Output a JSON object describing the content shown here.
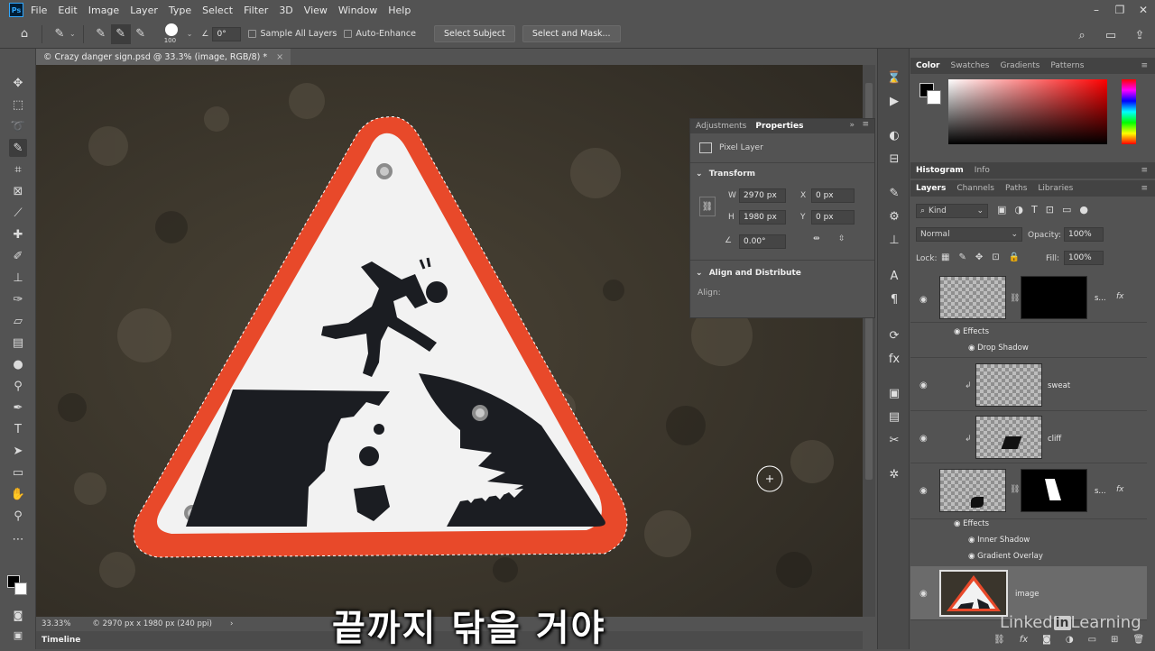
{
  "app": {
    "logo": "Ps"
  },
  "menu": [
    "File",
    "Edit",
    "Image",
    "Layer",
    "Type",
    "Select",
    "Filter",
    "3D",
    "View",
    "Window",
    "Help"
  ],
  "options": {
    "brush_size": "100",
    "angle": "0°",
    "sample_all_layers": "Sample All Layers",
    "auto_enhance": "Auto-Enhance",
    "select_subject": "Select Subject",
    "select_and_mask": "Select and Mask..."
  },
  "document": {
    "tab_title": "© Crazy danger sign.psd @ 33.3% (image, RGB/8) *",
    "close": "×"
  },
  "status": {
    "zoom": "33.33%",
    "info": "© 2970 px x 1980 px (240 ppi)",
    "arrow": "›"
  },
  "timeline": "Timeline",
  "subtitle": "끝까지 닦을 거야",
  "watermark": {
    "text1": "Linked",
    "text2": "in",
    "text3": " Learning"
  },
  "properties": {
    "tabs": [
      "Adjustments",
      "Properties"
    ],
    "layer_type": "Pixel Layer",
    "transform_label": "Transform",
    "w_label": "W",
    "w_value": "2970 px",
    "h_label": "H",
    "h_value": "1980 px",
    "x_label": "X",
    "x_value": "0 px",
    "y_label": "Y",
    "y_value": "0 px",
    "angle_value": "0.00°",
    "align_label": "Align and Distribute",
    "align_sub": "Align:"
  },
  "color_panel": {
    "tabs": [
      "Color",
      "Swatches",
      "Gradients",
      "Patterns"
    ]
  },
  "histo_panel": {
    "tabs": [
      "Histogram",
      "Info"
    ]
  },
  "layers_panel": {
    "tabs": [
      "Layers",
      "Channels",
      "Paths",
      "Libraries"
    ],
    "filter_kind": "Kind",
    "blend_mode": "Normal",
    "opacity_label": "Opacity:",
    "opacity_value": "100%",
    "lock_label": "Lock:",
    "fill_label": "Fill:",
    "fill_value": "100%",
    "layers": [
      {
        "name": "s...",
        "effects": [
          "Effects",
          "Drop Shadow"
        ]
      },
      {
        "name": "sweat"
      },
      {
        "name": "cliff"
      },
      {
        "name": "s...",
        "effects": [
          "Effects",
          "Inner Shadow",
          "Gradient Overlay"
        ]
      },
      {
        "name": "image"
      }
    ]
  },
  "colors": {
    "accent": "#31a8ff",
    "sign_red": "#e8492a",
    "sign_black": "#1b1d22"
  }
}
